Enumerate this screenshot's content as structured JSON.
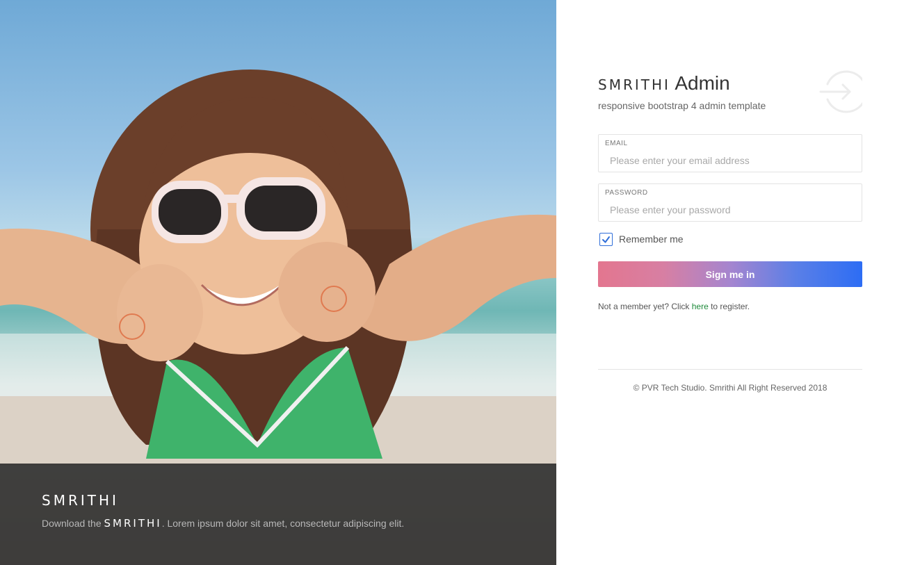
{
  "photo_panel": {
    "image_alt": "Girl in white sunglasses making a funny face at the beach",
    "caption": {
      "logo": "SMRITHI",
      "text_prefix": "Download the",
      "text_logo": "SMRITHI",
      "text_suffix": ". Lorem ipsum dolor sit amet, consectetur adipiscing elit."
    }
  },
  "brand": {
    "logo": "SMRITHI",
    "suffix": "Admin",
    "subtitle": "responsive bootstrap 4 admin template",
    "icon": "sign-in-icon"
  },
  "form": {
    "email": {
      "label": "EMAIL",
      "placeholder": "Please enter your email address",
      "value": ""
    },
    "password": {
      "label": "PASSWORD",
      "placeholder": "Please enter your password",
      "value": ""
    },
    "remember": {
      "label": "Remember me",
      "checked": true
    },
    "submit_label": "Sign me in",
    "register": {
      "prefix": "Not a member yet? Click",
      "link": "here",
      "suffix": "to register."
    }
  },
  "footer": {
    "copyright": "© PVR Tech Studio. Smrithi All Right Reserved 2018"
  },
  "colors": {
    "accent_blue": "#2d6df4",
    "accent_pink": "#e3768f",
    "link_green": "#1d8a3a",
    "caption_bg": "#282828"
  }
}
